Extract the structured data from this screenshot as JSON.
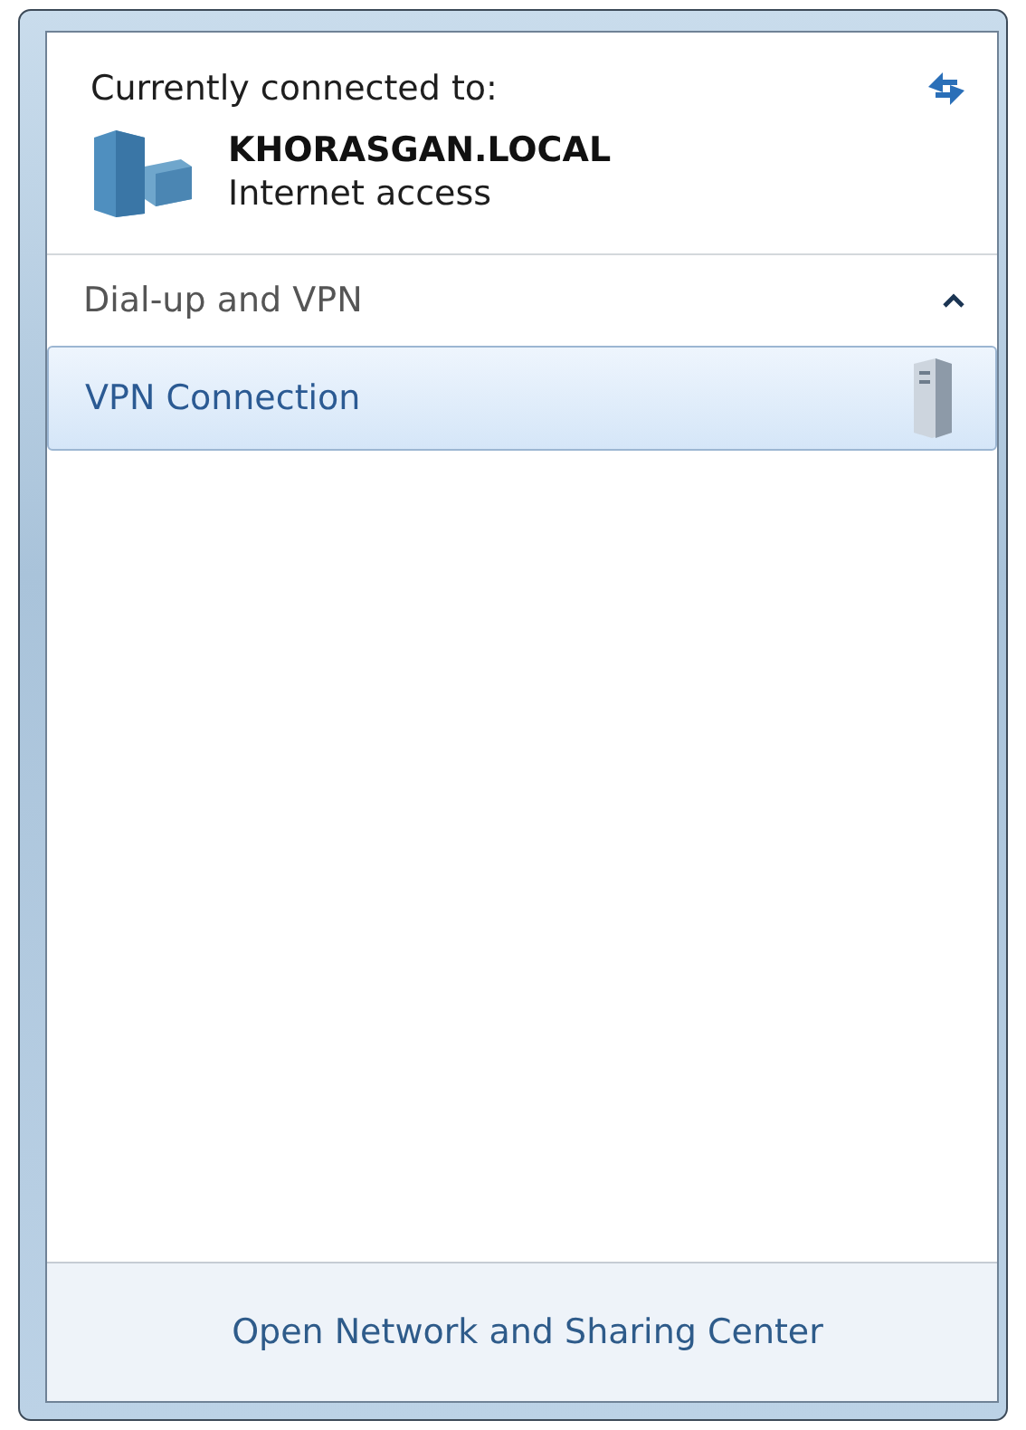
{
  "header": {
    "title": "Currently connected to:",
    "network": {
      "name": "KHORASGAN.LOCAL",
      "status": "Internet access"
    }
  },
  "groups": [
    {
      "title": "Dial-up and VPN",
      "expanded": true,
      "connections": [
        {
          "name": "VPN Connection",
          "selected": true
        }
      ]
    }
  ],
  "footer": {
    "link": "Open Network and Sharing Center"
  }
}
